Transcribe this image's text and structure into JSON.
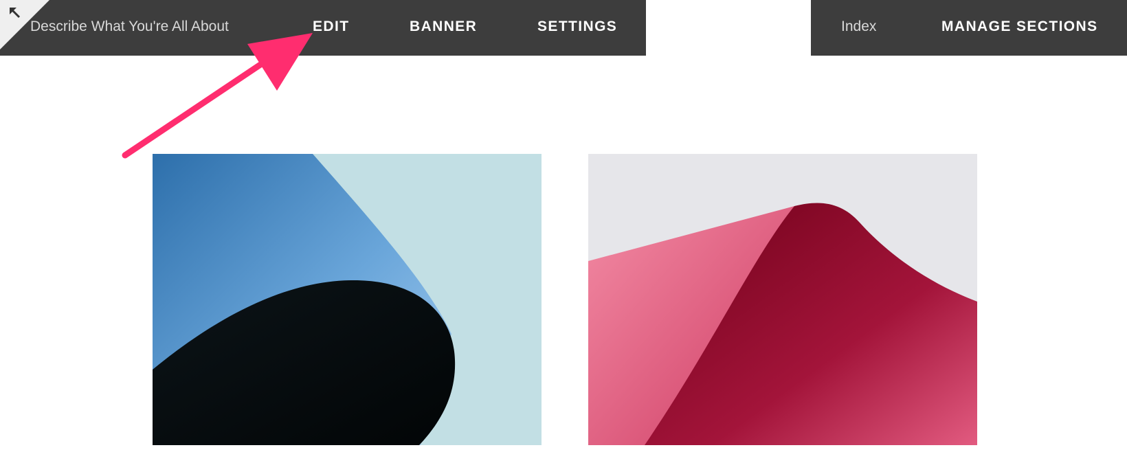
{
  "toolbar": {
    "site_description": "Describe What You're All About",
    "edit_label": "EDIT",
    "banner_label": "BANNER",
    "settings_label": "SETTINGS",
    "corner_icon": "arrow-up-left-icon"
  },
  "right_toolbar": {
    "index_label": "Index",
    "manage_sections_label": "MANAGE SECTIONS"
  },
  "gallery": {
    "images": [
      {
        "subject": "blue and black curled paper"
      },
      {
        "subject": "pink and crimson curled paper"
      }
    ]
  },
  "annotation": {
    "arrow_color": "#ff2d6f",
    "points_to": "EDIT"
  },
  "colors": {
    "toolbar_bg": "#3d3d3d",
    "toolbar_text": "#ffffff",
    "toolbar_muted_text": "#d9d9d9",
    "corner_tab_bg": "#efefef"
  }
}
